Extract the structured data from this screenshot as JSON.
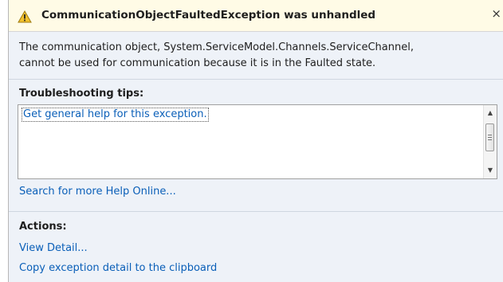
{
  "dialog": {
    "title": "CommunicationObjectFaultedException was unhandled",
    "close_glyph": "×",
    "message_line1": "The communication object, System.ServiceModel.Channels.ServiceChannel,",
    "message_line2": "cannot be used for communication because it is in the Faulted state."
  },
  "tips": {
    "heading": "Troubleshooting tips:",
    "items": [
      "Get general help for this exception."
    ],
    "search_link": "Search for more Help Online..."
  },
  "actions": {
    "heading": "Actions:",
    "items": [
      "View Detail...",
      "Copy exception detail to the clipboard"
    ]
  },
  "icons": {
    "title_icon": "warning-icon",
    "scroll_up": "scroll-up-icon",
    "scroll_down": "scroll-down-icon"
  },
  "colors": {
    "title_bg": "#fffbe6",
    "panel_bg": "#eef2f8",
    "link": "#0a5fb8",
    "warning_fill": "#f2c12e"
  }
}
